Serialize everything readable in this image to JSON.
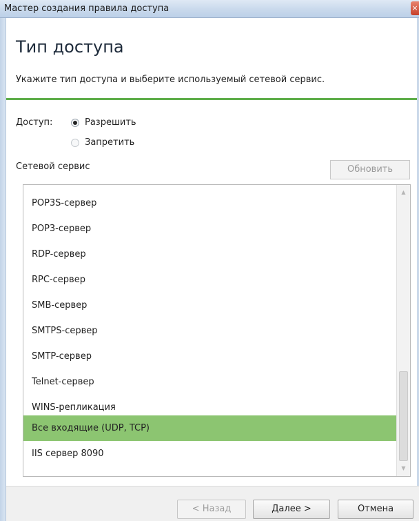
{
  "window": {
    "title": "Мастер создания правила доступа"
  },
  "page": {
    "heading": "Тип доступа",
    "subtitle": "Укажите тип доступа и выберите используемый сетевой сервис."
  },
  "access": {
    "label": "Доступ:",
    "options": [
      {
        "label": "Разрешить",
        "checked": true
      },
      {
        "label": "Запретить",
        "checked": false
      }
    ]
  },
  "service": {
    "label": "Сетевой сервис",
    "refresh_label": "Обновить",
    "items": [
      {
        "label": "POP3S-сервер",
        "selected": false
      },
      {
        "label": "POP3-сервер",
        "selected": false
      },
      {
        "label": "RDP-сервер",
        "selected": false
      },
      {
        "label": "RPC-сервер",
        "selected": false
      },
      {
        "label": "SMB-сервер",
        "selected": false
      },
      {
        "label": "SMTPS-сервер",
        "selected": false
      },
      {
        "label": "SMTP-сервер",
        "selected": false
      },
      {
        "label": "Telnet-сервер",
        "selected": false
      },
      {
        "label": "WINS-репликация",
        "selected": false
      },
      {
        "label": "Все входящие (UDP, TCP)",
        "selected": true
      },
      {
        "label": "IIS сервер 8090",
        "selected": false
      }
    ]
  },
  "footer": {
    "back_label": "< Назад",
    "next_label": "Далее >",
    "cancel_label": "Отмена"
  },
  "colors": {
    "accent_rule": "#5fae4a",
    "selection": "#8cc571"
  }
}
